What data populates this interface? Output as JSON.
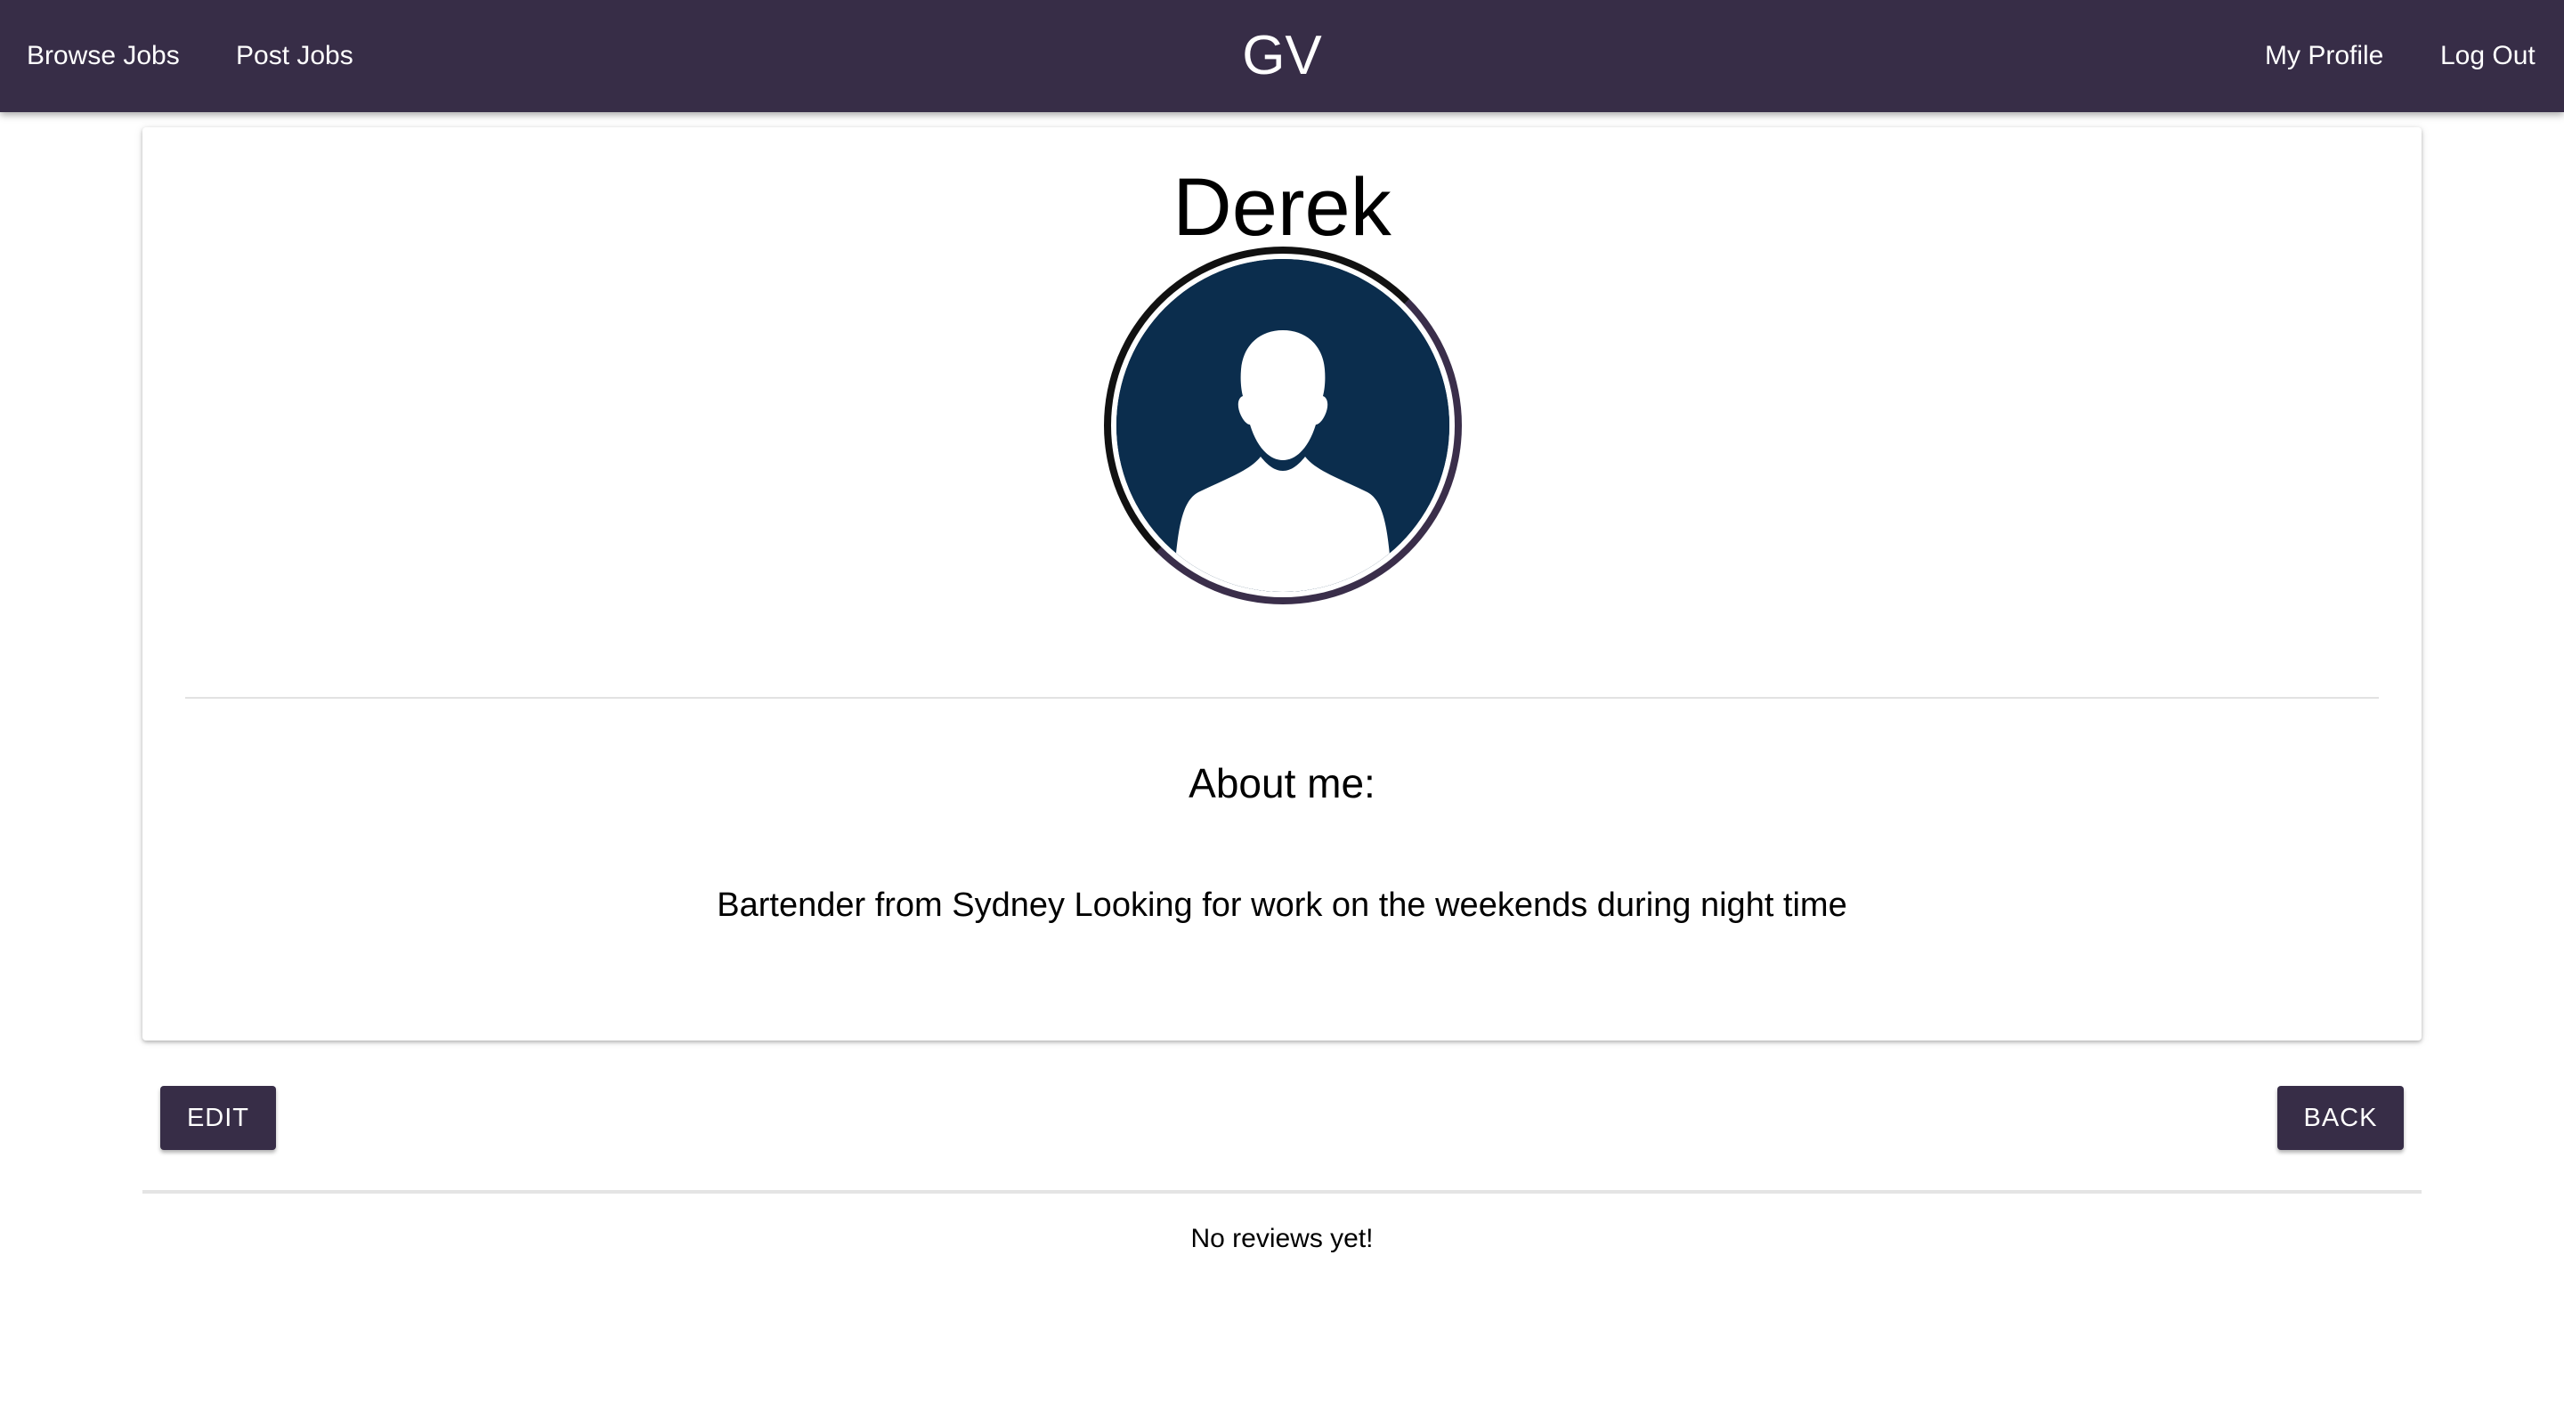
{
  "navbar": {
    "brand": "GV",
    "left_links": [
      "Browse Jobs",
      "Post Jobs"
    ],
    "right_links": [
      "My Profile",
      "Log Out"
    ]
  },
  "profile": {
    "name": "Derek",
    "avatar_icon": "user-silhouette-icon",
    "about_title": "About me:",
    "about_text": "Bartender from Sydney Looking for work on the weekends during night time"
  },
  "actions": {
    "edit_label": "EDIT",
    "back_label": "BACK"
  },
  "reviews": {
    "empty_message": "No reviews yet!"
  },
  "colors": {
    "primary": "#372d47",
    "avatar_background": "#0b2d4d",
    "text": "#000000",
    "background": "#ffffff"
  }
}
